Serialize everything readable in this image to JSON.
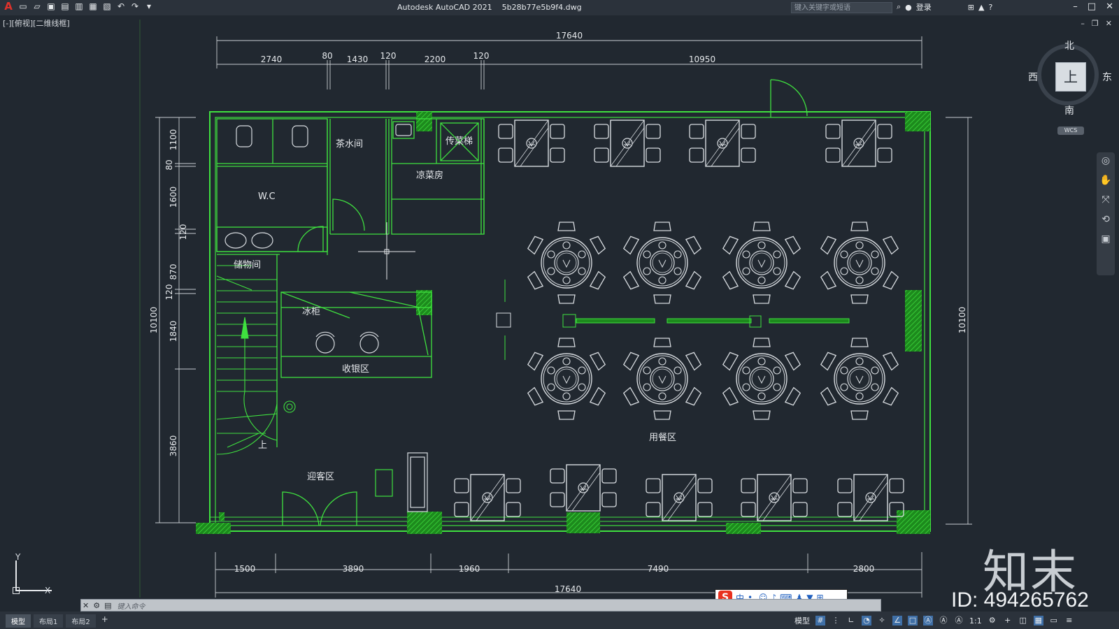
{
  "app": {
    "title": "Autodesk AutoCAD 2021",
    "filename": "5b28b77e5b9f4.dwg",
    "search_placeholder": "键入关键字或短语",
    "login_label": "登录",
    "view_control": "[-][俯视][二维线框]"
  },
  "viewcube": {
    "north": "北",
    "south": "南",
    "east": "东",
    "west": "西",
    "face": "上",
    "wcs": "WCS"
  },
  "ucs": {
    "x": "X",
    "y": "Y"
  },
  "command": {
    "placeholder": "键入命令"
  },
  "tabs": [
    {
      "label": "模型"
    },
    {
      "label": "布局1"
    },
    {
      "label": "布局2"
    }
  ],
  "status": {
    "model": "模型",
    "scale": "1:1"
  },
  "ime": {
    "lang": "中"
  },
  "drawing": {
    "dims_top_total": "17640",
    "dims_top": [
      "2740",
      "80",
      "1430",
      "120",
      "2200",
      "120",
      "10950"
    ],
    "dims_bottom_total": "17640",
    "dims_bottom": [
      "1500",
      "3890",
      "1960",
      "7490",
      "2800"
    ],
    "dims_left": [
      "1100",
      "80",
      "1600",
      "120",
      "870",
      "120",
      "1840",
      "3860"
    ],
    "dims_left_total": "10100",
    "dims_right_total": "10100",
    "rooms": {
      "tea_room": "茶水间",
      "dumbwaiter": "传菜梯",
      "cold_kitchen": "凉菜房",
      "wc": "W.C",
      "storage": "储物间",
      "fridge": "冰柜",
      "cashier": "收银区",
      "reception": "迎客区",
      "dining": "用餐区",
      "stair_up": "上"
    }
  },
  "watermark": {
    "logo": "知末",
    "id": "ID: 494265762"
  }
}
